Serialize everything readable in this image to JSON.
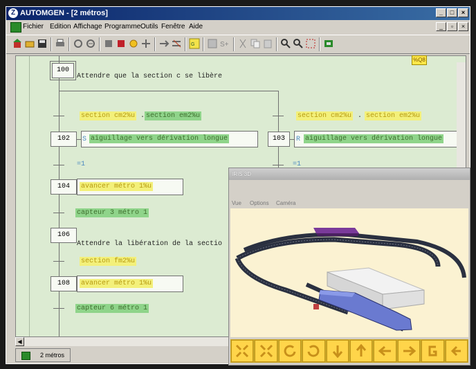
{
  "app": {
    "title": "AUTOMGEN - [2 métros]",
    "window_buttons": [
      "_",
      "□",
      "×"
    ]
  },
  "menu": {
    "items": [
      "Fichier",
      "Edition",
      "Affichage",
      "Programme",
      "Outils",
      "Fenêtre",
      "Aide"
    ],
    "mdi_buttons": [
      "_",
      "▫",
      "×"
    ]
  },
  "toolbar": {
    "icons": [
      "new-icon",
      "open-icon",
      "save-icon",
      "print-icon",
      "zoom-fit-icon",
      "zoom-area-icon",
      "block-icon",
      "red-block-icon",
      "sun-icon",
      "cross-icon",
      "arrow-right-icon",
      "arrow-cross-icon",
      "grafcet-icon",
      "grid-icon",
      "s-plus-icon",
      "cut-icon",
      "copy-icon",
      "paste-icon",
      "zoom-in-icon",
      "zoom-out-icon",
      "frame-icon",
      "run-icon"
    ],
    "corner_badge": "%Q8"
  },
  "grafcet": {
    "steps": [
      {
        "num": "100",
        "text": "Attendre que la section c se libère"
      },
      {
        "num": "102",
        "prefix": "S",
        "action": "aiguillage vers dérivation longue"
      },
      {
        "num": "103",
        "prefix": "R",
        "action": "aiguillage vers dérivation longue"
      },
      {
        "num": "104",
        "action": "avancer métro 1%u"
      },
      {
        "num": "106",
        "text": "Attendre la libération de la sectio"
      },
      {
        "num": "108",
        "action": "avancer métro 1%u"
      }
    ],
    "transitions": {
      "t1_left_a": "section cm2%u",
      "t1_left_sep": ".",
      "t1_left_b": "section em2%u",
      "t1_right_a": "section cm2%u",
      "t1_right_sep": ".",
      "t1_right_b": "section em2%u",
      "t2_left": "=1",
      "t2_right": "=1",
      "t3": "capteur 3 métro 1",
      "t4": "section fm2%u",
      "t5": "capteur 6 métro 1"
    }
  },
  "doc_tab": {
    "label": "2 métros"
  },
  "iris": {
    "title": "IRIS 3D",
    "menu": [
      "Vue",
      "Options",
      "Caméra"
    ],
    "controls": [
      "expand-icon",
      "collapse-icon",
      "rotate-left-icon",
      "rotate-right-icon",
      "move-down-icon",
      "move-up-icon",
      "move-left-icon",
      "move-right-icon",
      "zoom-g-icon",
      "zoom-out-cam-icon"
    ]
  }
}
